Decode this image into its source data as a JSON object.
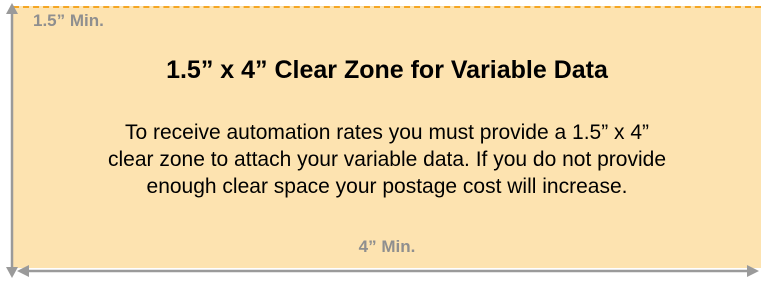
{
  "diagram": {
    "height_label": "1.5” Min.",
    "title": "1.5” x 4” Clear Zone for Variable Data",
    "body_lines": [
      "To receive automation rates you must provide a 1.5” x 4”",
      "clear zone to attach your variable data. If you do not provide",
      "enough clear space your postage cost will increase."
    ],
    "width_label": "4” Min."
  },
  "colors": {
    "zone_fill": "#fde3b0",
    "dashed_border": "#f5a623",
    "arrow": "#9a9a9a",
    "label_gray": "#8f8f8f"
  }
}
